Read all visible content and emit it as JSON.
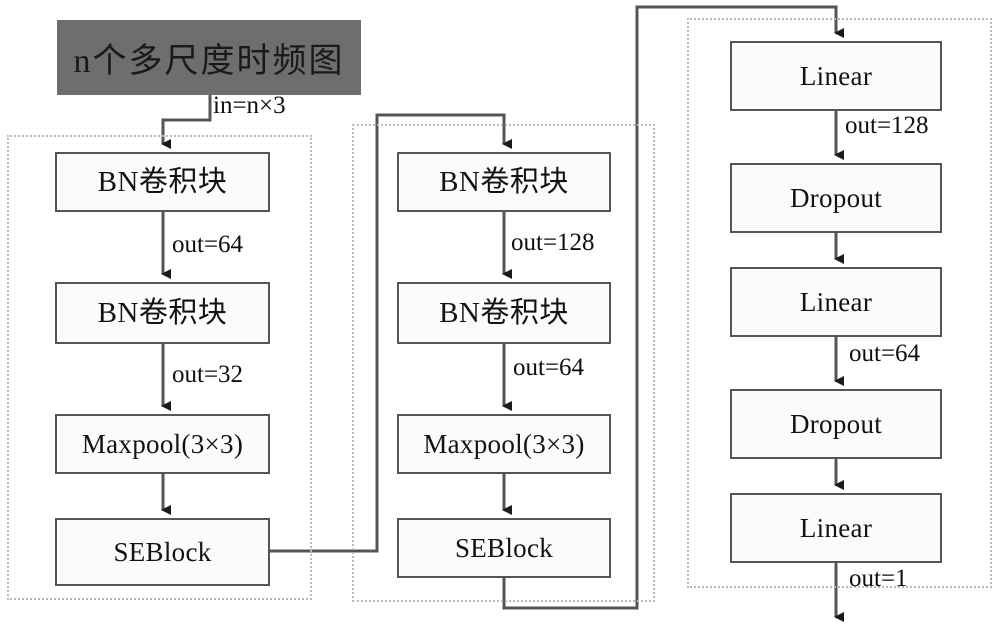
{
  "diagram": {
    "title_block": {
      "label": "n个多尺度时频图",
      "fill_color": "#6e6e6e"
    },
    "groups": [
      {
        "name": "stage-1-group"
      },
      {
        "name": "stage-2-group"
      },
      {
        "name": "classifier-group"
      }
    ],
    "columns": [
      {
        "name": "stage-1",
        "nodes": [
          {
            "label": "BN卷积块",
            "script": "cjk"
          },
          {
            "label": "BN卷积块",
            "script": "cjk"
          },
          {
            "label": "Maxpool(3×3)",
            "script": "latin"
          },
          {
            "label": "SEBlock",
            "script": "latin"
          }
        ]
      },
      {
        "name": "stage-2",
        "nodes": [
          {
            "label": "BN卷积块",
            "script": "cjk"
          },
          {
            "label": "BN卷积块",
            "script": "cjk"
          },
          {
            "label": "Maxpool(3×3)",
            "script": "latin"
          },
          {
            "label": "SEBlock",
            "script": "latin"
          }
        ]
      },
      {
        "name": "classifier",
        "nodes": [
          {
            "label": "Linear",
            "script": "latin"
          },
          {
            "label": "Dropout",
            "script": "latin"
          },
          {
            "label": "Linear",
            "script": "latin"
          },
          {
            "label": "Dropout",
            "script": "latin"
          },
          {
            "label": "Linear",
            "script": "latin"
          }
        ]
      }
    ],
    "edge_labels": [
      {
        "name": "edge-label-input",
        "text": "in=n×3"
      },
      {
        "name": "edge-label-s1-bn1-out",
        "text": "out=64"
      },
      {
        "name": "edge-label-s1-bn2-out",
        "text": "out=32"
      },
      {
        "name": "edge-label-s2-bn1-out",
        "text": "out=128"
      },
      {
        "name": "edge-label-s2-bn2-out",
        "text": "out=64"
      },
      {
        "name": "edge-label-fc1-out",
        "text": "out=128"
      },
      {
        "name": "edge-label-fc2-out",
        "text": "out=64"
      },
      {
        "name": "edge-label-fc3-out",
        "text": "out=1"
      }
    ],
    "colors": {
      "node_border": "#555555",
      "node_fill": "#fbfbfb",
      "group_border": "#b9b9b9",
      "edge_stroke": "#555555",
      "text": "#121212"
    }
  }
}
